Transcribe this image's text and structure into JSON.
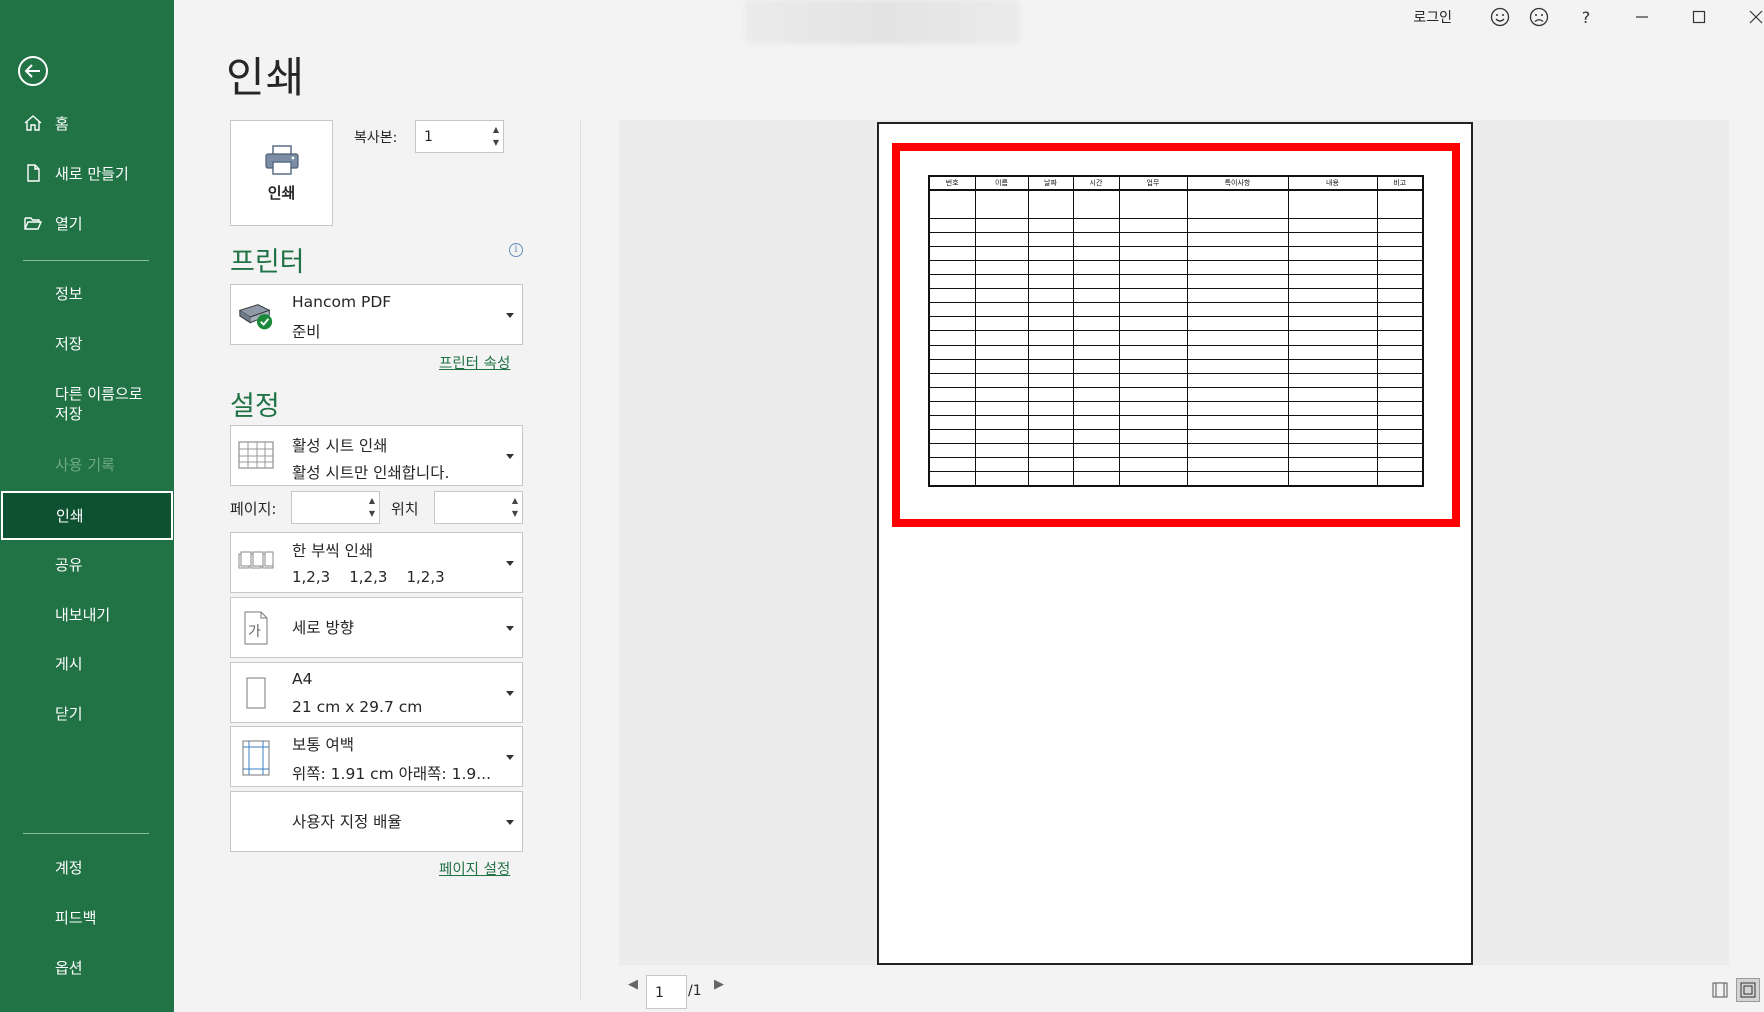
{
  "window": {
    "login_label": "로그인",
    "icons": [
      "smiley-icon",
      "frown-icon",
      "help-icon",
      "minimize-icon",
      "maximize-icon",
      "close-icon"
    ],
    "help_glyph": "?"
  },
  "sidebar": {
    "bg": "#217346",
    "selected_bg": "#0e5130",
    "top_items": [
      {
        "label": "홈",
        "icon": "home-icon"
      },
      {
        "label": "새로 만들기",
        "icon": "new-file-icon"
      },
      {
        "label": "열기",
        "icon": "folder-open-icon"
      }
    ],
    "middle_items": [
      {
        "label": "정보"
      },
      {
        "label": "저장"
      },
      {
        "label": "다른 이름으로\n저장"
      },
      {
        "label": "사용 기록"
      },
      {
        "label": "인쇄"
      },
      {
        "label": "공유"
      },
      {
        "label": "내보내기"
      },
      {
        "label": "게시"
      },
      {
        "label": "닫기"
      }
    ],
    "bottom_items": [
      {
        "label": "계정"
      },
      {
        "label": "피드백"
      },
      {
        "label": "옵션"
      }
    ]
  },
  "main": {
    "title": "인쇄",
    "print_button_label": "인쇄",
    "copies_label": "복사본:",
    "copies_value": "1",
    "printer_heading": "프린터",
    "printer": {
      "name": "Hancom PDF",
      "status": "준비"
    },
    "printer_properties_link": "프린터 속성",
    "settings_heading": "설정",
    "settings": {
      "print_what": {
        "line1": "활성 시트 인쇄",
        "line2": "활성 시트만 인쇄합니다."
      },
      "pages_label": "페이지:",
      "pages_from": "",
      "to_label": "위치",
      "pages_to": "",
      "collation": {
        "line1": "한 부씩 인쇄",
        "line2": "1,2,3    1,2,3    1,2,3"
      },
      "orientation": {
        "line1": "세로 방향",
        "icon_glyph": "가"
      },
      "paper": {
        "line1": "A4",
        "line2": "21 cm x 29.7 cm"
      },
      "margins": {
        "line1": "보통 여백",
        "line2": "위쪽: 1.91 cm 아래쪽: 1.9..."
      },
      "scaling": {
        "line1": "사용자 지정 배율"
      }
    },
    "page_setup_link": "페이지 설정"
  },
  "preview": {
    "highlight_color": "#ff0000",
    "table_headers": [
      "번호",
      "이름",
      "날짜",
      "시간",
      "업무",
      "특이사항",
      "내용",
      "비고"
    ],
    "empty_rows": 20,
    "current_page": "1",
    "total_pages": "/1"
  }
}
